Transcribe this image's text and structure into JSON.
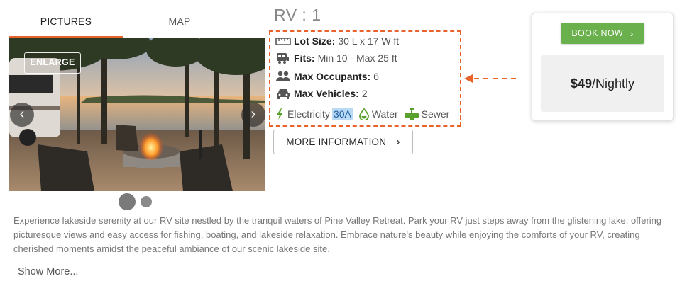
{
  "tabs": [
    {
      "label": "PICTURES",
      "active": true
    },
    {
      "label": "MAP",
      "active": false
    }
  ],
  "gallery": {
    "enlarge_label": "ENLARGE",
    "prev_icon": "chevron-left-icon",
    "next_icon": "chevron-right-icon",
    "slide_count": 2,
    "active_slide": 1
  },
  "site": {
    "title": "RV : 1",
    "lot_size_label": "Lot Size:",
    "lot_size_value": "30 L x 17 W ft",
    "fits_label": "Fits:",
    "fits_value": "Min 10 - Max 25 ft",
    "max_occupants_label": "Max Occupants:",
    "max_occupants_value": "6",
    "max_vehicles_label": "Max Vehicles:",
    "max_vehicles_value": "2",
    "utilities": {
      "electricity_label": "Electricity",
      "electricity_amp": "30A",
      "water_label": "Water",
      "sewer_label": "Sewer"
    },
    "more_info_label": "MORE INFORMATION"
  },
  "booking": {
    "book_label": "BOOK NOW",
    "price": "$49",
    "unit": "/Nightly"
  },
  "description": "Experience lakeside serenity at our RV site nestled by the tranquil waters of Pine Valley Retreat. Park your RV just steps away from the glistening lake, offering picturesque views and easy access for fishing, boating, and lakeside relaxation. Embrace nature's beauty while enjoying the comforts of your RV, creating cherished moments amidst the peaceful ambiance of our scenic lakeside site.",
  "show_more_label": "Show More...",
  "colors": {
    "accent_orange": "#e8632a",
    "book_green": "#6ab04c",
    "utility_green": "#5aa02c",
    "amp_highlight": "#b9d9f5"
  }
}
